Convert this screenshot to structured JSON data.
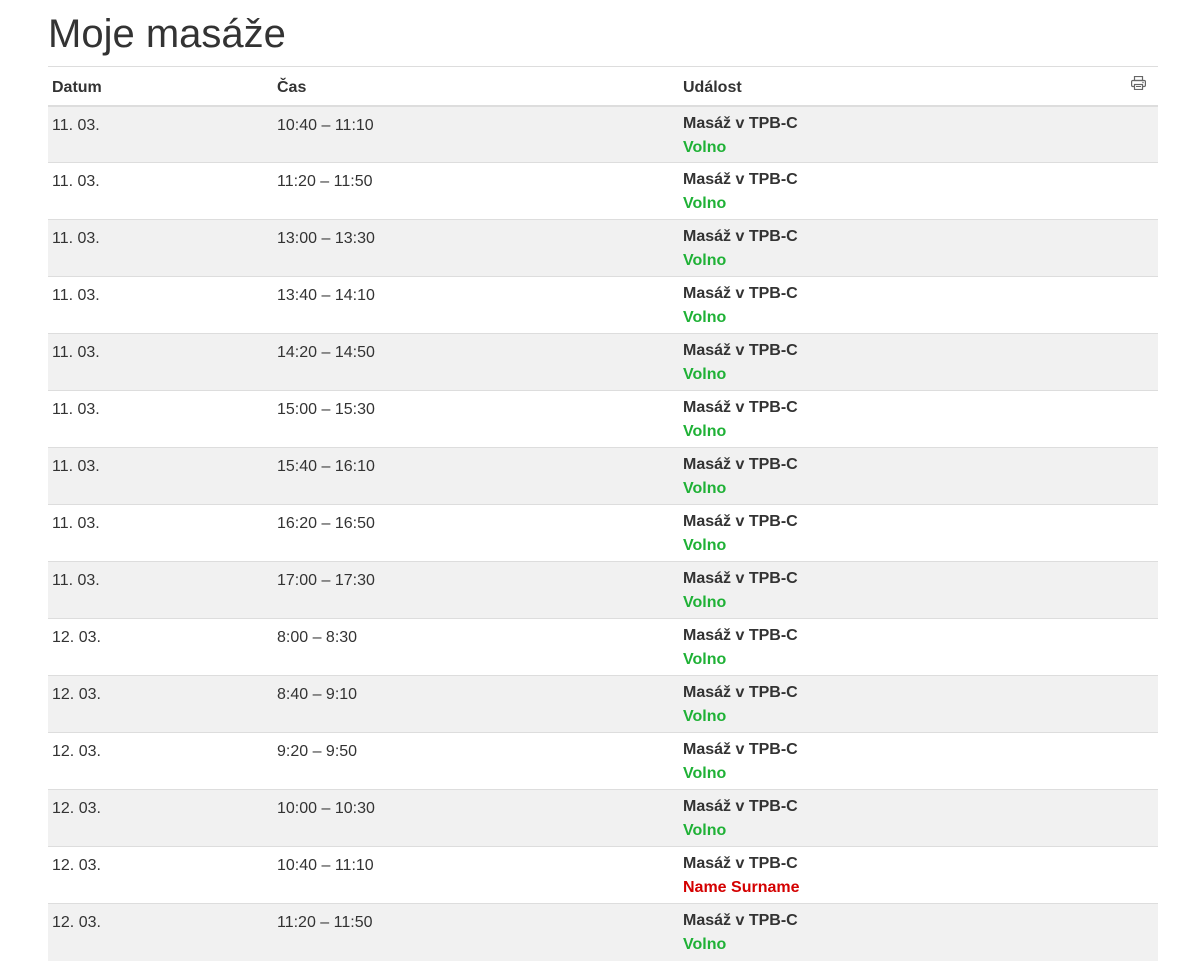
{
  "page": {
    "title": "Moje masáže"
  },
  "table": {
    "headers": {
      "date": "Datum",
      "time": "Čas",
      "event": "Událost"
    },
    "print_icon": "print-icon",
    "rows": [
      {
        "date": "11. 03.",
        "time": "10:40 – 11:10",
        "event": "Masáž v TPB-C",
        "status": "Volno",
        "status_type": "free"
      },
      {
        "date": "11. 03.",
        "time": "11:20 – 11:50",
        "event": "Masáž v TPB-C",
        "status": "Volno",
        "status_type": "free"
      },
      {
        "date": "11. 03.",
        "time": "13:00 – 13:30",
        "event": "Masáž v TPB-C",
        "status": "Volno",
        "status_type": "free"
      },
      {
        "date": "11. 03.",
        "time": "13:40 – 14:10",
        "event": "Masáž v TPB-C",
        "status": "Volno",
        "status_type": "free"
      },
      {
        "date": "11. 03.",
        "time": "14:20 – 14:50",
        "event": "Masáž v TPB-C",
        "status": "Volno",
        "status_type": "free"
      },
      {
        "date": "11. 03.",
        "time": "15:00 – 15:30",
        "event": "Masáž v TPB-C",
        "status": "Volno",
        "status_type": "free"
      },
      {
        "date": "11. 03.",
        "time": "15:40 – 16:10",
        "event": "Masáž v TPB-C",
        "status": "Volno",
        "status_type": "free"
      },
      {
        "date": "11. 03.",
        "time": "16:20 – 16:50",
        "event": "Masáž v TPB-C",
        "status": "Volno",
        "status_type": "free"
      },
      {
        "date": "11. 03.",
        "time": "17:00 – 17:30",
        "event": "Masáž v TPB-C",
        "status": "Volno",
        "status_type": "free"
      },
      {
        "date": "12. 03.",
        "time": "8:00 – 8:30",
        "event": "Masáž v TPB-C",
        "status": "Volno",
        "status_type": "free"
      },
      {
        "date": "12. 03.",
        "time": "8:40 – 9:10",
        "event": "Masáž v TPB-C",
        "status": "Volno",
        "status_type": "free"
      },
      {
        "date": "12. 03.",
        "time": "9:20 – 9:50",
        "event": "Masáž v TPB-C",
        "status": "Volno",
        "status_type": "free"
      },
      {
        "date": "12. 03.",
        "time": "10:00 – 10:30",
        "event": "Masáž v TPB-C",
        "status": "Volno",
        "status_type": "free"
      },
      {
        "date": "12. 03.",
        "time": "10:40 – 11:10",
        "event": "Masáž v TPB-C",
        "status": "Name Surname",
        "status_type": "booked"
      },
      {
        "date": "12. 03.",
        "time": "11:20 – 11:50",
        "event": "Masáž v TPB-C",
        "status": "Volno",
        "status_type": "free"
      }
    ]
  },
  "colors": {
    "free": "#1fb136",
    "booked": "#d40000",
    "text": "#333333",
    "stripe": "#f1f1f1",
    "border": "#dddddd"
  }
}
